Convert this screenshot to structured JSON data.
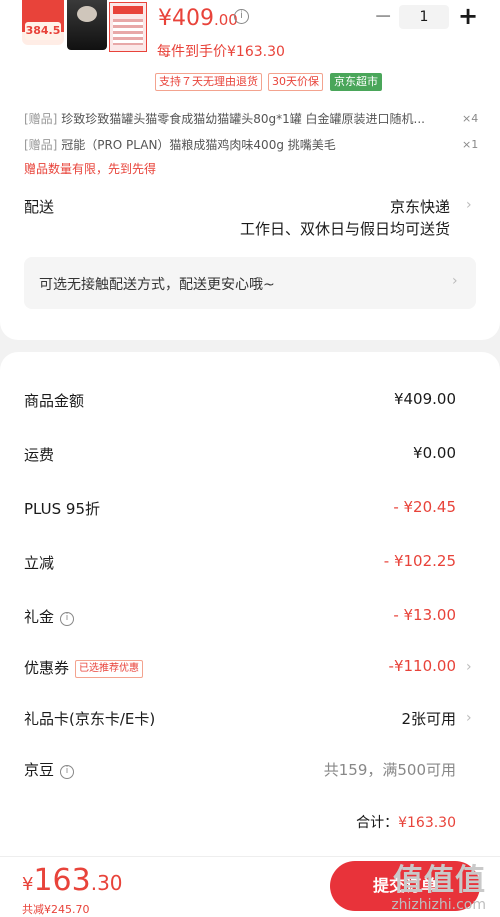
{
  "item": {
    "thumb_badge": "384.5",
    "price_main": "¥409",
    "price_cents": ".00",
    "qty_minus": "−",
    "quantity": "1",
    "qty_plus": "+",
    "unit_price": "每件到手价¥163.30",
    "tags": [
      "支持７天无理由退货",
      "30天价保",
      "京东超市"
    ]
  },
  "gifts": [
    {
      "tag": "[赠品]",
      "name": "珍致珍致猫罐头猫零食成猫幼猫罐头80g*1罐 白金罐原装进口随机...",
      "qty": "×4"
    },
    {
      "tag": "[赠品]",
      "name": "冠能（PRO PLAN）猫粮成猫鸡肉味400g 挑嘴美毛",
      "qty": "×1"
    }
  ],
  "gift_note": "赠品数量有限，先到先得",
  "delivery": {
    "label": "配送",
    "carrier": "京东快递",
    "schedule": "工作日、双休日与假日均可送货",
    "contactless": "可选无接触配送方式，配送更安心哦~"
  },
  "summary": [
    {
      "label": "商品金额",
      "value": "¥409.00",
      "style": "dark"
    },
    {
      "label": "运费",
      "value": "¥0.00",
      "style": "dark"
    },
    {
      "label": "PLUS 95折",
      "value": "- ¥20.45",
      "style": "red"
    },
    {
      "label": "立减",
      "value": "- ¥102.25",
      "style": "red"
    },
    {
      "label": "礼金",
      "value": "- ¥13.00",
      "style": "red",
      "info": true
    },
    {
      "label": "优惠券",
      "value": "-¥110.00",
      "style": "red",
      "tag": "已选推荐优惠",
      "chevron": true
    },
    {
      "label": "礼品卡(京东卡/E卡)",
      "value": "2张可用",
      "style": "dark",
      "chevron": true
    },
    {
      "label": "京豆",
      "value": "共159，满500可用",
      "style": "gray",
      "info": true
    }
  ],
  "total": {
    "label": "合计：",
    "amount": "¥163.30"
  },
  "bottom_bar": {
    "yen": "¥",
    "price": "163",
    "cents": ".30",
    "saved": "共减¥245.70",
    "submit": "提交订单"
  },
  "watermark": {
    "logo": "值值值",
    "text": "zhizhizhi.com"
  },
  "colors": {
    "accent": "#e8433a",
    "jd_supermarket": "#4aa65a",
    "background": "#f2f2f2"
  }
}
